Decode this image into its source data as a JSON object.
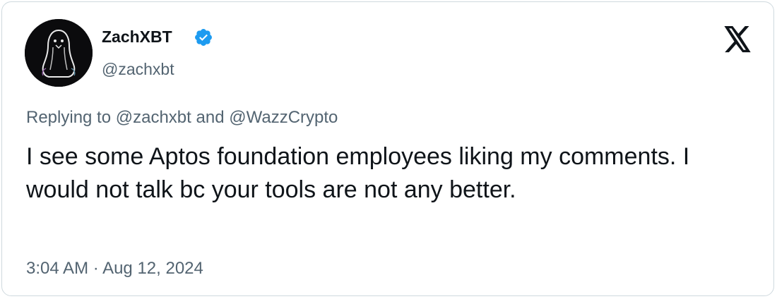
{
  "author": {
    "display_name": "ZachXBT",
    "handle": "@zachxbt",
    "verified_icon": "verified-badge-icon",
    "avatar_icon": "ghost-penguin-avatar"
  },
  "brand": {
    "logo_icon": "x-logo-icon"
  },
  "reply": {
    "prefix": "Replying to",
    "mention_1": "@zachxbt",
    "conjunction": "and",
    "mention_2": "@WazzCrypto"
  },
  "tweet": {
    "text": "I see some Aptos foundation employees liking my comments. I would not talk bc your tools are not any better.",
    "time": "3:04 AM",
    "separator": "·",
    "date": "Aug 12, 2024"
  },
  "colors": {
    "text_primary": "#0f1419",
    "text_secondary": "#536471",
    "verified_blue": "#1d9bf0",
    "border": "#cfd9de"
  }
}
